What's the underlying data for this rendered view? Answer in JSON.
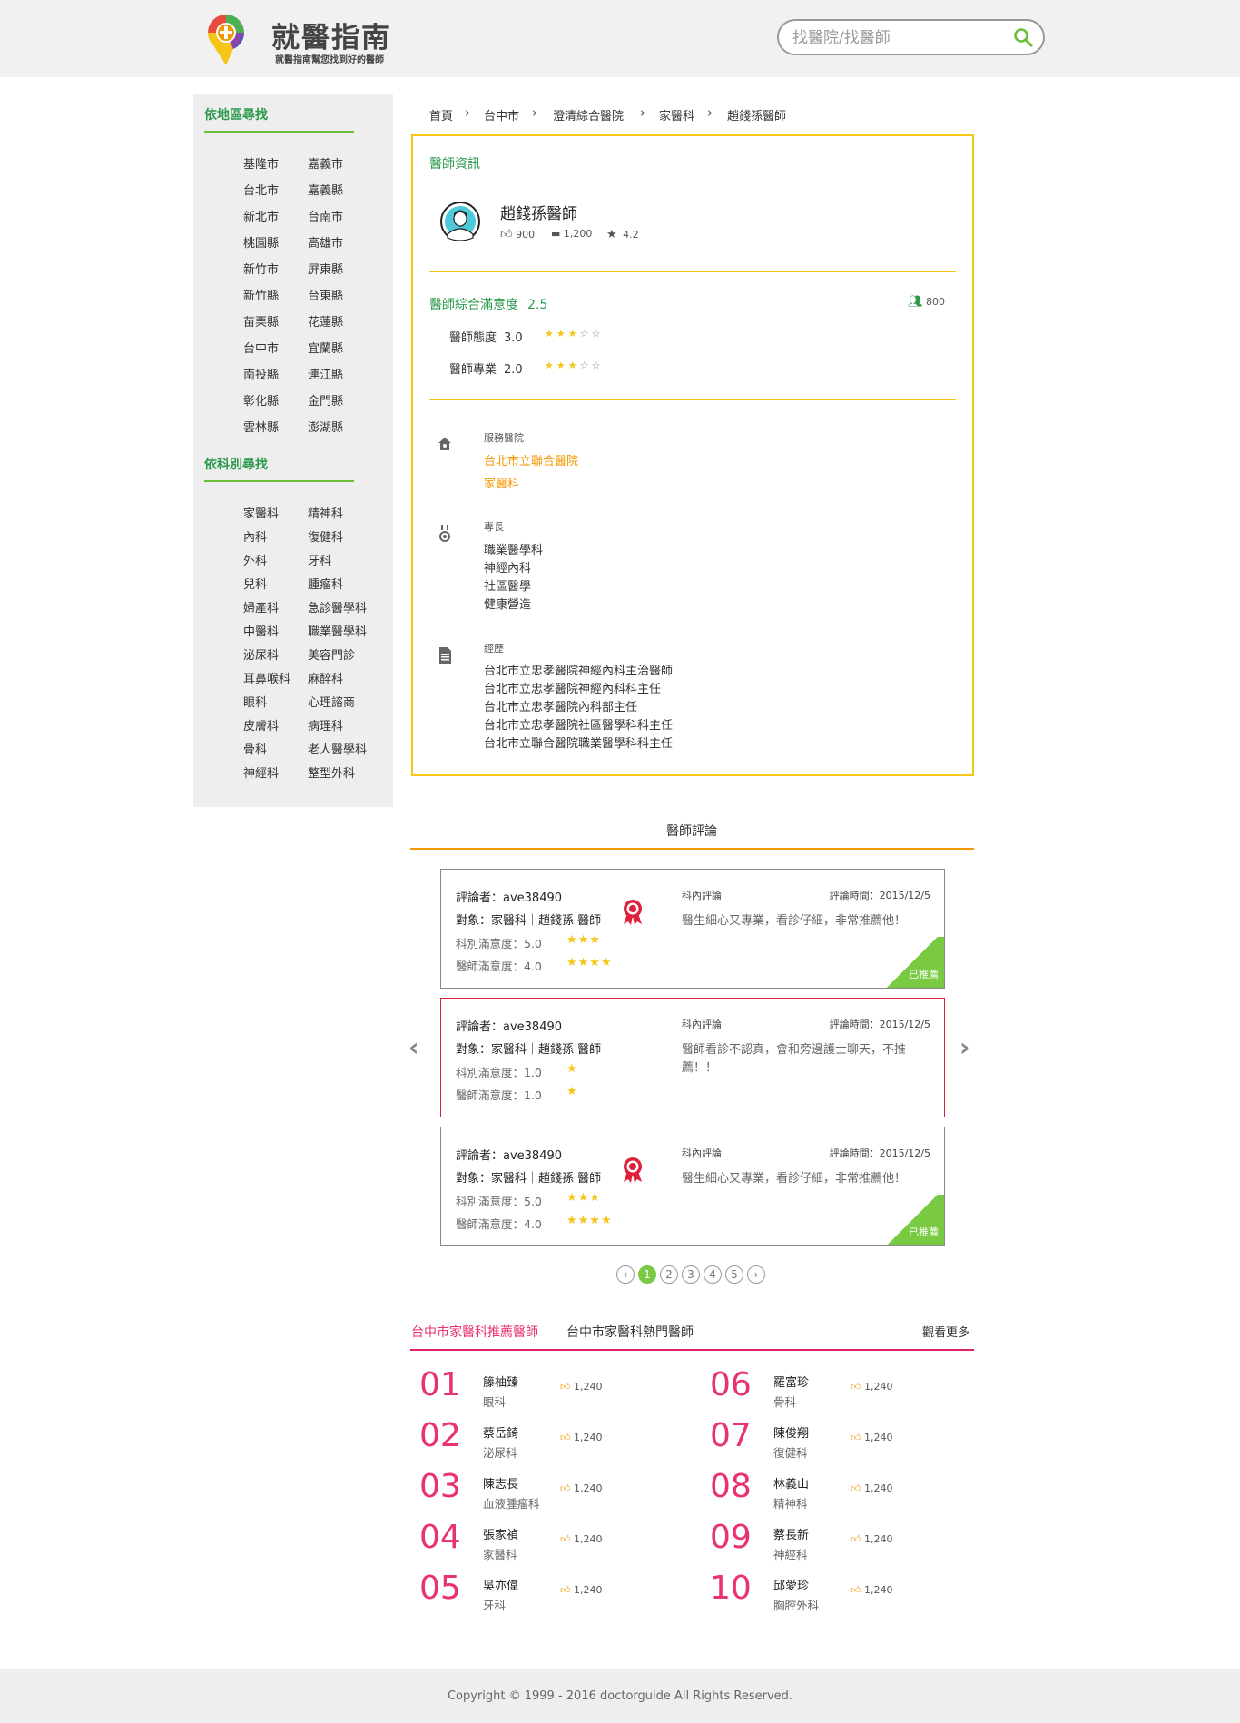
{
  "header": {
    "title": "就醫指南",
    "subtitle": "就醫指南幫您找到好的醫師",
    "search_placeholder": "找醫院/找醫師"
  },
  "sidebar": {
    "region_heading": "依地區尋找",
    "regions_col1": [
      "基隆市",
      "台北市",
      "新北市",
      "桃園縣",
      "新竹市",
      "新竹縣",
      "苗栗縣",
      "台中市",
      "南投縣",
      "彰化縣",
      "雲林縣"
    ],
    "regions_col2": [
      "嘉義市",
      "嘉義縣",
      "台南市",
      "高雄市",
      "屏東縣",
      "台東縣",
      "花蓮縣",
      "宜蘭縣",
      "連江縣",
      "金門縣",
      "澎湖縣"
    ],
    "dept_heading": "依科別尋找",
    "depts_col1": [
      "家醫科",
      "內科",
      "外科",
      "兒科",
      "婦產科",
      "中醫科",
      "泌尿科",
      "耳鼻喉科",
      "眼科",
      "皮膚科",
      "骨科",
      "神經科"
    ],
    "depts_col2": [
      "精神科",
      "復健科",
      "牙科",
      "腫瘤科",
      "急診醫學科",
      "職業醫學科",
      "美容門診",
      "麻醉科",
      "心理諮商",
      "病理科",
      "老人醫學科",
      "整型外科"
    ]
  },
  "breadcrumb": [
    "首頁",
    "台中市",
    "澄清綜合醫院",
    "家醫科",
    "趙錢孫醫師"
  ],
  "doctor": {
    "section_title": "醫師資訊",
    "name": "趙錢孫醫師",
    "likes": "900",
    "comments": "1,200",
    "rating": "4.2",
    "satisfaction_label": "醫師綜合滿意度",
    "satisfaction_value": "2.5",
    "reviewers": "800",
    "attitude_label": "醫師態度",
    "attitude_value": "3.0",
    "attitude_stars": 3,
    "professional_label": "醫師專業",
    "professional_value": "2.0",
    "professional_stars": 3,
    "hospital_label": "服務醫院",
    "hospital": "台北市立聯合醫院",
    "hospital_dept": "家醫科",
    "specialty_label": "專長",
    "specialties": [
      "職業醫學科",
      "神經內科",
      "社區醫學",
      "健康營造"
    ],
    "experience_label": "經歷",
    "experience": [
      "台北市立忠孝醫院神經內科主治醫師",
      "台北市立忠孝醫院神經內科科主任",
      "台北市立忠孝醫院內科部主任",
      "台北市立忠孝醫院社區醫學科科主任",
      "台北市立聯合醫院職業醫學科科主任"
    ]
  },
  "reviews": {
    "title": "醫師評論",
    "items": [
      {
        "by": "評論者：ave38490",
        "target": "對象：家醫科｜趙錢孫 醫師",
        "dept_sat": "科別滿意度：5.0",
        "dept_stars": "★★★",
        "doc_sat": "醫師滿意度：4.0",
        "doc_stars": "★★★★",
        "category": "科內評論",
        "time": "評論時間：2015/12/5",
        "comment": "醫生細心又專業，看診仔細，非常推薦他！",
        "badge": "已推薦"
      },
      {
        "by": "評論者：ave38490",
        "target": "對象：家醫科｜趙錢孫 醫師",
        "dept_sat": "科別滿意度：1.0",
        "dept_stars": "★",
        "doc_sat": "醫師滿意度：1.0",
        "doc_stars": "★",
        "category": "科內評論",
        "time": "評論時間：2015/12/5",
        "comment": "醫師看診不認真，會和旁邊護士聊天，不推薦！！"
      },
      {
        "by": "評論者：ave38490",
        "target": "對象：家醫科｜趙錢孫 醫師",
        "dept_sat": "科別滿意度：5.0",
        "dept_stars": "★★★",
        "doc_sat": "醫師滿意度：4.0",
        "doc_stars": "★★★★",
        "category": "科內評論",
        "time": "評論時間：2015/12/5",
        "comment": "醫生細心又專業，看診仔細，非常推薦他！",
        "badge": "已推薦"
      }
    ],
    "pages": [
      "1",
      "2",
      "3",
      "4",
      "5"
    ],
    "prev": "‹",
    "next": "›"
  },
  "ranking": {
    "tab_recommended": "台中市家醫科推薦醫師",
    "tab_popular": "台中市家醫科熱門醫師",
    "more": "觀看更多",
    "left": [
      {
        "num": "01",
        "name": "籐柚臻",
        "dept": "眼科",
        "likes": "1,240"
      },
      {
        "num": "02",
        "name": "蔡岳錡",
        "dept": "泌尿科",
        "likes": "1,240"
      },
      {
        "num": "03",
        "name": "陳志長",
        "dept": "血液腫瘤科",
        "likes": "1,240"
      },
      {
        "num": "04",
        "name": "張家禎",
        "dept": "家醫科",
        "likes": "1,240"
      },
      {
        "num": "05",
        "name": "吳亦偉",
        "dept": "牙科",
        "likes": "1,240"
      }
    ],
    "right": [
      {
        "num": "06",
        "name": "羅富珍",
        "dept": "骨科",
        "likes": "1,240"
      },
      {
        "num": "07",
        "name": "陳俊翔",
        "dept": "復健科",
        "likes": "1,240"
      },
      {
        "num": "08",
        "name": "林義山",
        "dept": "精神科",
        "likes": "1,240"
      },
      {
        "num": "09",
        "name": "蔡長新",
        "dept": "神經科",
        "likes": "1,240"
      },
      {
        "num": "10",
        "name": "邱愛珍",
        "dept": "胸腔外科",
        "likes": "1,240"
      }
    ]
  },
  "footer": {
    "copyright": "Copyright © 1999 - 2016 doctorguide All Rights Reserved."
  },
  "colors": {
    "green": "#2b9a4b",
    "yellow": "#f5c518",
    "orange": "#f39800",
    "pink": "#e8336d",
    "red": "#e0213b",
    "badge_green": "#7ac943"
  }
}
